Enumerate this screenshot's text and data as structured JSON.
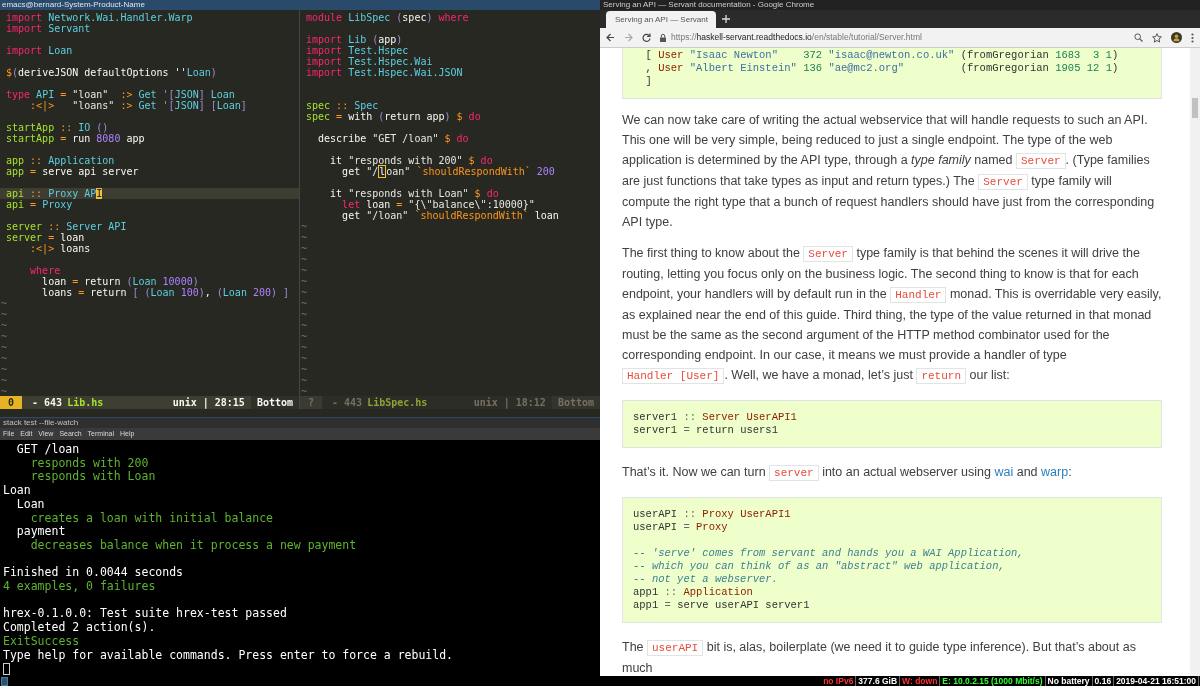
{
  "editor": {
    "title": "emacs@bernard-System-Product-Name",
    "panes": [
      {
        "active": true,
        "lines": [
          {
            "kind": "code",
            "segments": [
              {
                "kind": "kw",
                "text": "import"
              },
              {
                "kind": "ty",
                "text": " Network.Wai.Handler.Warp"
              }
            ]
          },
          {
            "kind": "code",
            "segments": [
              {
                "kind": "kw",
                "text": "import"
              },
              {
                "kind": "ty",
                "text": " Servant"
              }
            ]
          },
          {
            "kind": "blank"
          },
          {
            "kind": "code",
            "segments": [
              {
                "kind": "kw",
                "text": "import"
              },
              {
                "kind": "ty",
                "text": " Loan"
              }
            ]
          },
          {
            "kind": "blank"
          },
          {
            "kind": "code",
            "segments": [
              {
                "kind": "op",
                "text": "$"
              },
              {
                "kind": "par",
                "text": "("
              },
              {
                "kind": "tx",
                "text": "deriveJSON defaultOptions ''"
              },
              {
                "kind": "ty",
                "text": "Loan"
              },
              {
                "kind": "par",
                "text": ")"
              }
            ]
          },
          {
            "kind": "blank"
          },
          {
            "kind": "code",
            "segments": [
              {
                "kind": "kw",
                "text": "type"
              },
              {
                "kind": "ty",
                "text": " API"
              },
              {
                "kind": "op",
                "text": " ="
              },
              {
                "kind": "str",
                "text": " \"loan\""
              },
              {
                "kind": "op",
                "text": "  :>"
              },
              {
                "kind": "ty",
                "text": " Get"
              },
              {
                "kind": "par",
                "text": " '["
              },
              {
                "kind": "ty",
                "text": "JSON"
              },
              {
                "kind": "par",
                "text": "]"
              },
              {
                "kind": "ty",
                "text": " Loan"
              }
            ]
          },
          {
            "kind": "code",
            "segments": [
              {
                "kind": "op",
                "text": "    :<|>"
              },
              {
                "kind": "str",
                "text": "   \"loans\""
              },
              {
                "kind": "op",
                "text": " :>"
              },
              {
                "kind": "ty",
                "text": " Get"
              },
              {
                "kind": "par",
                "text": " '["
              },
              {
                "kind": "ty",
                "text": "JSON"
              },
              {
                "kind": "par",
                "text": "] ["
              },
              {
                "kind": "ty",
                "text": "Loan"
              },
              {
                "kind": "par",
                "text": "]"
              }
            ]
          },
          {
            "kind": "blank"
          },
          {
            "kind": "code",
            "segments": [
              {
                "kind": "fn",
                "text": "startApp"
              },
              {
                "kind": "op",
                "text": " ::"
              },
              {
                "kind": "ty",
                "text": " IO"
              },
              {
                "kind": "par",
                "text": " ()"
              }
            ]
          },
          {
            "kind": "code",
            "segments": [
              {
                "kind": "fn",
                "text": "startApp"
              },
              {
                "kind": "op",
                "text": " ="
              },
              {
                "kind": "tx",
                "text": " run"
              },
              {
                "kind": "num",
                "text": " 8080"
              },
              {
                "kind": "tx",
                "text": " app"
              }
            ]
          },
          {
            "kind": "blank"
          },
          {
            "kind": "code",
            "segments": [
              {
                "kind": "fn",
                "text": "app"
              },
              {
                "kind": "op",
                "text": " ::"
              },
              {
                "kind": "ty",
                "text": " Application"
              }
            ]
          },
          {
            "kind": "code",
            "segments": [
              {
                "kind": "fn",
                "text": "app"
              },
              {
                "kind": "op",
                "text": " ="
              },
              {
                "kind": "tx",
                "text": " serve api server"
              }
            ]
          },
          {
            "kind": "blank"
          },
          {
            "kind": "code",
            "segments": [
              {
                "kind": "fn",
                "text": "api"
              },
              {
                "kind": "op",
                "text": " ::"
              },
              {
                "kind": "ty",
                "text": " Proxy AP"
              },
              {
                "kind": "cur",
                "text": "I"
              }
            ]
          },
          {
            "kind": "code",
            "segments": [
              {
                "kind": "fn",
                "text": "api"
              },
              {
                "kind": "op",
                "text": " ="
              },
              {
                "kind": "ty",
                "text": " Proxy"
              }
            ]
          },
          {
            "kind": "blank"
          },
          {
            "kind": "code",
            "segments": [
              {
                "kind": "fn",
                "text": "server"
              },
              {
                "kind": "op",
                "text": " ::"
              },
              {
                "kind": "ty",
                "text": " Server API"
              }
            ]
          },
          {
            "kind": "code",
            "segments": [
              {
                "kind": "fn",
                "text": "server"
              },
              {
                "kind": "op",
                "text": " ="
              },
              {
                "kind": "tx",
                "text": " loan"
              }
            ]
          },
          {
            "kind": "code",
            "segments": [
              {
                "kind": "op",
                "text": "    :<|>"
              },
              {
                "kind": "tx",
                "text": " loans"
              }
            ]
          },
          {
            "kind": "blank"
          },
          {
            "kind": "code",
            "segments": [
              {
                "kind": "kw",
                "text": "    where"
              }
            ]
          },
          {
            "kind": "code",
            "segments": [
              {
                "kind": "tx",
                "text": "      loan"
              },
              {
                "kind": "op",
                "text": " ="
              },
              {
                "kind": "tx",
                "text": " return"
              },
              {
                "kind": "par",
                "text": " ("
              },
              {
                "kind": "ty",
                "text": "Loan"
              },
              {
                "kind": "num",
                "text": " 10000"
              },
              {
                "kind": "par",
                "text": ")"
              }
            ]
          },
          {
            "kind": "code",
            "segments": [
              {
                "kind": "tx",
                "text": "      loans"
              },
              {
                "kind": "op",
                "text": " ="
              },
              {
                "kind": "tx",
                "text": " return"
              },
              {
                "kind": "par",
                "text": " [ ("
              },
              {
                "kind": "ty",
                "text": "Loan"
              },
              {
                "kind": "num",
                "text": " 100"
              },
              {
                "kind": "par",
                "text": ")"
              },
              {
                "kind": "tx",
                "text": ", "
              },
              {
                "kind": "par",
                "text": "("
              },
              {
                "kind": "ty",
                "text": "Loan"
              },
              {
                "kind": "num",
                "text": " 200"
              },
              {
                "kind": "par",
                "text": ") ]"
              }
            ]
          }
        ],
        "tildes": [
          "~",
          "~",
          "~",
          "~",
          "~",
          "~",
          "~",
          "~",
          "~"
        ],
        "status": {
          "badge": "0",
          "size": "- 643",
          "file": "Lib.hs",
          "encoding": "unix | 28:15",
          "position": "Bottom"
        }
      },
      {
        "active": false,
        "lines": [
          {
            "kind": "code",
            "segments": [
              {
                "kind": "kw",
                "text": "module"
              },
              {
                "kind": "ty",
                "text": " LibSpec"
              },
              {
                "kind": "par",
                "text": " ("
              },
              {
                "kind": "tx",
                "text": "spec"
              },
              {
                "kind": "par",
                "text": ")"
              },
              {
                "kind": "kw",
                "text": " where"
              }
            ]
          },
          {
            "kind": "blank"
          },
          {
            "kind": "code",
            "segments": [
              {
                "kind": "kw",
                "text": "import"
              },
              {
                "kind": "ty",
                "text": " Lib"
              },
              {
                "kind": "par",
                "text": " ("
              },
              {
                "kind": "tx",
                "text": "app"
              },
              {
                "kind": "par",
                "text": ")"
              }
            ]
          },
          {
            "kind": "code",
            "segments": [
              {
                "kind": "kw",
                "text": "import"
              },
              {
                "kind": "ty",
                "text": " Test.Hspec"
              }
            ]
          },
          {
            "kind": "code",
            "segments": [
              {
                "kind": "kw",
                "text": "import"
              },
              {
                "kind": "ty",
                "text": " Test.Hspec.Wai"
              }
            ]
          },
          {
            "kind": "code",
            "segments": [
              {
                "kind": "kw",
                "text": "import"
              },
              {
                "kind": "ty",
                "text": " Test.Hspec.Wai.JSON"
              }
            ]
          },
          {
            "kind": "blank"
          },
          {
            "kind": "blank"
          },
          {
            "kind": "code",
            "segments": [
              {
                "kind": "fn",
                "text": "spec"
              },
              {
                "kind": "op",
                "text": " ::"
              },
              {
                "kind": "ty",
                "text": " Spec"
              }
            ]
          },
          {
            "kind": "code",
            "segments": [
              {
                "kind": "fn",
                "text": "spec"
              },
              {
                "kind": "op",
                "text": " ="
              },
              {
                "kind": "tx",
                "text": " with"
              },
              {
                "kind": "par",
                "text": " ("
              },
              {
                "kind": "tx",
                "text": "return app"
              },
              {
                "kind": "par",
                "text": ")"
              },
              {
                "kind": "op",
                "text": " $"
              },
              {
                "kind": "kw",
                "text": " do"
              }
            ]
          },
          {
            "kind": "blank"
          },
          {
            "kind": "code",
            "segments": [
              {
                "kind": "tx",
                "text": "  describe"
              },
              {
                "kind": "str",
                "text": " \"GET /loan\""
              },
              {
                "kind": "op",
                "text": " $"
              },
              {
                "kind": "kw",
                "text": " do"
              }
            ]
          },
          {
            "kind": "blank"
          },
          {
            "kind": "code",
            "segments": [
              {
                "kind": "tx",
                "text": "    it"
              },
              {
                "kind": "str",
                "text": " \"responds with 200\""
              },
              {
                "kind": "op",
                "text": " $"
              },
              {
                "kind": "kw",
                "text": " do"
              }
            ]
          },
          {
            "kind": "code",
            "segments": [
              {
                "kind": "tx",
                "text": "      get"
              },
              {
                "kind": "str",
                "text": " \"/"
              },
              {
                "kind": "hcur",
                "text": "l"
              },
              {
                "kind": "str",
                "text": "oan\""
              },
              {
                "kind": "op",
                "text": " `shouldRespondWith`"
              },
              {
                "kind": "num",
                "text": " 200"
              }
            ]
          },
          {
            "kind": "blank"
          },
          {
            "kind": "code",
            "segments": [
              {
                "kind": "tx",
                "text": "    it"
              },
              {
                "kind": "str",
                "text": " \"responds with Loan\""
              },
              {
                "kind": "op",
                "text": " $"
              },
              {
                "kind": "kw",
                "text": " do"
              }
            ]
          },
          {
            "kind": "code",
            "segments": [
              {
                "kind": "kw",
                "text": "      let"
              },
              {
                "kind": "tx",
                "text": " loan"
              },
              {
                "kind": "op",
                "text": " ="
              },
              {
                "kind": "str",
                "text": " \"{\\\"balance\\\":10000}\""
              }
            ]
          },
          {
            "kind": "code",
            "segments": [
              {
                "kind": "tx",
                "text": "      get"
              },
              {
                "kind": "str",
                "text": " \"/loan\""
              },
              {
                "kind": "op",
                "text": " `shouldRespondWith`"
              },
              {
                "kind": "tx",
                "text": " loan"
              }
            ]
          }
        ],
        "tildes": [
          "~",
          "~",
          "~",
          "~",
          "~",
          "~",
          "~",
          "~",
          "~",
          "~",
          "~",
          "~",
          "~",
          "~",
          "~",
          "~"
        ],
        "status": {
          "badge": "?",
          "size": "- 443",
          "file": "LibSpec.hs",
          "encoding": "unix | 18:12",
          "position": "Bottom"
        }
      }
    ]
  },
  "terminal": {
    "title": "stack test --file-watch",
    "menu": [
      "File",
      "Edit",
      "View",
      "Search",
      "Terminal",
      "Help"
    ],
    "lines": [
      {
        "kind": "plain",
        "text": "  GET /loan"
      },
      {
        "kind": "pass",
        "text": "    responds with 200"
      },
      {
        "kind": "pass",
        "text": "    responds with Loan"
      },
      {
        "kind": "plain",
        "text": "Loan"
      },
      {
        "kind": "plain",
        "text": "  Loan"
      },
      {
        "kind": "pass",
        "text": "    creates a loan with initial balance"
      },
      {
        "kind": "plain",
        "text": "  payment"
      },
      {
        "kind": "pass",
        "text": "    decreases balance when it process a new payment"
      },
      {
        "kind": "blank"
      },
      {
        "kind": "plain",
        "text": "Finished in 0.0044 seconds"
      },
      {
        "kind": "pass",
        "text": "4 examples, 0 failures"
      },
      {
        "kind": "blank"
      },
      {
        "kind": "plain",
        "text": "hrex-0.1.0.0: Test suite hrex-test passed"
      },
      {
        "kind": "plain",
        "text": "Completed 2 action(s)."
      },
      {
        "kind": "pass",
        "text": "ExitSuccess"
      },
      {
        "kind": "plain",
        "text": "Type help for available commands. Press enter to force a rebuild."
      },
      {
        "kind": "cursor"
      }
    ]
  },
  "browser": {
    "title": "Serving an API — Servant documentation - Google Chrome",
    "tabs": [
      {
        "title": "Serving an API — Servant",
        "selected": true
      }
    ],
    "url": {
      "scheme": "https://",
      "domain": "haskell-servant.readthedocs.io",
      "path": "/en/stable/tutorial/Server.html"
    },
    "blocks": [
      {
        "kind": "code",
        "lines": [
          {
            "kind": "code",
            "segments": [
              {
                "kind": "tx",
                "text": "  [ "
              },
              {
                "kind": "cls",
                "text": "User"
              },
              {
                "kind": "str",
                "text": " \"Isaac Newton\""
              },
              {
                "kind": "num",
                "text": "    372"
              },
              {
                "kind": "str",
                "text": " \"isaac@newton.co.uk\""
              },
              {
                "kind": "tx",
                "text": " (fromGregorian"
              },
              {
                "kind": "num",
                "text": " 1683  3 1"
              },
              {
                "kind": "tx",
                "text": ")"
              }
            ]
          },
          {
            "kind": "code",
            "segments": [
              {
                "kind": "tx",
                "text": "  , "
              },
              {
                "kind": "cls",
                "text": "User"
              },
              {
                "kind": "str",
                "text": " \"Albert Einstein\""
              },
              {
                "kind": "num",
                "text": " 136"
              },
              {
                "kind": "str",
                "text": " \"ae@mc2.org\""
              },
              {
                "kind": "tx",
                "text": "         (fromGregorian"
              },
              {
                "kind": "num",
                "text": " 1905 12 1"
              },
              {
                "kind": "tx",
                "text": ")"
              }
            ]
          },
          {
            "kind": "code",
            "segments": [
              {
                "kind": "tx",
                "text": "  ]"
              }
            ]
          }
        ]
      },
      {
        "kind": "paragraph",
        "segments": [
          {
            "kind": "text",
            "text": "We can now take care of writing the actual webservice that will handle requests to such an API. This one will be very simple, being reduced to just a single endpoint. The type of the web application is determined by the API type, through a "
          },
          {
            "kind": "em",
            "text": "type family"
          },
          {
            "kind": "text",
            "text": " named "
          },
          {
            "kind": "code",
            "text": "Server"
          },
          {
            "kind": "text",
            "text": ". (Type families are just functions that take types as input and return types.) The "
          },
          {
            "kind": "code",
            "text": "Server"
          },
          {
            "kind": "text",
            "text": " type family will compute the right type that a bunch of request handlers should have just from the corresponding API type."
          }
        ]
      },
      {
        "kind": "paragraph",
        "segments": [
          {
            "kind": "text",
            "text": "The first thing to know about the "
          },
          {
            "kind": "code",
            "text": "Server"
          },
          {
            "kind": "text",
            "text": " type family is that behind the scenes it will drive the routing, letting you focus only on the business logic. The second thing to know is that for each endpoint, your handlers will by default run in the "
          },
          {
            "kind": "code",
            "text": "Handler"
          },
          {
            "kind": "text",
            "text": " monad. This is overridable very easily, as explained near the end of this guide. Third thing, the type of the value returned in that monad must be the same as the second argument of the HTTP method combinator used for the corresponding endpoint. In our case, it means we must provide a handler of type "
          },
          {
            "kind": "code",
            "text": "Handler [User]"
          },
          {
            "kind": "text",
            "text": ". Well, we have a monad, let’s just "
          },
          {
            "kind": "code",
            "text": "return"
          },
          {
            "kind": "text",
            "text": " our list:"
          }
        ]
      },
      {
        "kind": "code",
        "lines": [
          {
            "kind": "code",
            "segments": [
              {
                "kind": "tx",
                "text": "server1 "
              },
              {
                "kind": "op",
                "text": "::"
              },
              {
                "kind": "cls",
                "text": " Server UserAPI1"
              }
            ]
          },
          {
            "kind": "code",
            "segments": [
              {
                "kind": "tx",
                "text": "server1 "
              },
              {
                "kind": "op",
                "text": "="
              },
              {
                "kind": "tx",
                "text": " return users1"
              }
            ]
          }
        ]
      },
      {
        "kind": "paragraph",
        "segments": [
          {
            "kind": "text",
            "text": "That’s it. Now we can turn "
          },
          {
            "kind": "code",
            "text": "server"
          },
          {
            "kind": "text",
            "text": " into an actual webserver using "
          },
          {
            "kind": "link",
            "text": "wai"
          },
          {
            "kind": "text",
            "text": " and "
          },
          {
            "kind": "link",
            "text": "warp"
          },
          {
            "kind": "text",
            "text": ":"
          }
        ]
      },
      {
        "kind": "code",
        "lines": [
          {
            "kind": "code",
            "segments": [
              {
                "kind": "tx",
                "text": "userAPI "
              },
              {
                "kind": "op",
                "text": "::"
              },
              {
                "kind": "cls",
                "text": " Proxy UserAPI1"
              }
            ]
          },
          {
            "kind": "code",
            "segments": [
              {
                "kind": "tx",
                "text": "userAPI "
              },
              {
                "kind": "op",
                "text": "="
              },
              {
                "kind": "cls",
                "text": " Proxy"
              }
            ]
          },
          {
            "kind": "blank"
          },
          {
            "kind": "code",
            "segments": [
              {
                "kind": "com",
                "text": "-- 'serve' comes from servant and hands you a WAI Application,"
              }
            ]
          },
          {
            "kind": "code",
            "segments": [
              {
                "kind": "com",
                "text": "-- which you can think of as an \"abstract\" web application,"
              }
            ]
          },
          {
            "kind": "code",
            "segments": [
              {
                "kind": "com",
                "text": "-- not yet a webserver."
              }
            ]
          },
          {
            "kind": "code",
            "segments": [
              {
                "kind": "tx",
                "text": "app1 "
              },
              {
                "kind": "op",
                "text": "::"
              },
              {
                "kind": "cls",
                "text": " Application"
              }
            ]
          },
          {
            "kind": "code",
            "segments": [
              {
                "kind": "tx",
                "text": "app1 "
              },
              {
                "kind": "op",
                "text": "="
              },
              {
                "kind": "tx",
                "text": " serve userAPI server1"
              }
            ]
          }
        ]
      },
      {
        "kind": "paragraph",
        "segments": [
          {
            "kind": "text",
            "text": "The "
          },
          {
            "kind": "code",
            "text": "userAPI"
          },
          {
            "kind": "text",
            "text": " bit is, alas, boilerplate (we need it to guide type inference). But that’s about as much"
          }
        ]
      }
    ]
  },
  "status_bar": {
    "items": [
      {
        "text": "no IPv6",
        "color": "#ff3333"
      },
      {
        "text": "377.6 GiB",
        "color": "#ffffff"
      },
      {
        "text": "W: down",
        "color": "#ff3333"
      },
      {
        "text": "E: 10.0.2.15 (1000 Mbit/s)",
        "color": "#33ff33"
      },
      {
        "text": "No battery",
        "color": "#ffffff"
      },
      {
        "text": "0.16",
        "color": "#ffffff"
      },
      {
        "text": "2019-04-21 16:51:00",
        "color": "#ffffff"
      }
    ]
  }
}
